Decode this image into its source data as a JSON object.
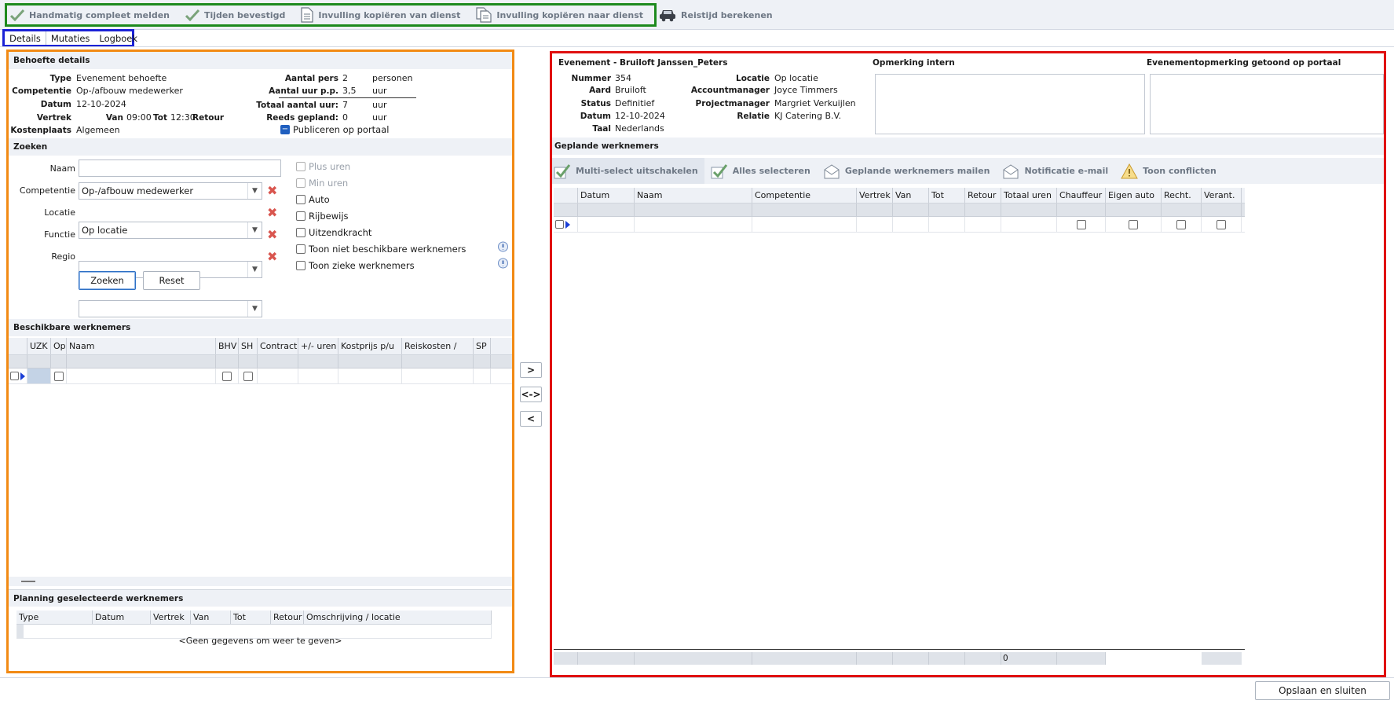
{
  "toolbar": {
    "items": [
      {
        "label": "Handmatig compleet melden",
        "icon": "checkmark-icon"
      },
      {
        "label": "Tijden bevestigd",
        "icon": "checkmark-icon"
      },
      {
        "label": "Invulling kopiëren van dienst",
        "icon": "document-icon"
      },
      {
        "label": "Invulling kopiëren naar dienst",
        "icon": "copy-documents-icon"
      },
      {
        "label": "Reistijd berekenen",
        "icon": "car-icon"
      }
    ]
  },
  "tabs": [
    "Details",
    "Mutaties",
    "Logboek"
  ],
  "behoefte": {
    "title": "Behoefte details",
    "type_label": "Type",
    "type_value": "Evenement behoefte",
    "competentie_label": "Competentie",
    "competentie_value": "Op-/afbouw medewerker",
    "datum_label": "Datum",
    "datum_value": "12-10-2024",
    "vertrek_label": "Vertrek",
    "van_label": "Van",
    "van_value": "09:00",
    "tot_label": "Tot",
    "tot_value": "12:30",
    "retour_label": "Retour",
    "kostenplaats_label": "Kostenplaats",
    "kostenplaats_value": "Algemeen",
    "aantal_pers_label": "Aantal pers",
    "aantal_pers_value": "2",
    "aantal_pers_unit": "personen",
    "aantal_uur_label": "Aantal uur p.p.",
    "aantal_uur_value": "3,5",
    "aantal_uur_unit": "uur",
    "totaal_label": "Totaal aantal uur:",
    "totaal_value": "7",
    "totaal_unit": "uur",
    "reeds_label": "Reeds gepland:",
    "reeds_value": "0",
    "reeds_unit": "uur",
    "publiceren_label": "Publiceren op portaal"
  },
  "zoeken": {
    "title": "Zoeken",
    "naam_label": "Naam",
    "naam_value": "",
    "competentie_label": "Competentie",
    "competentie_value": "Op-/afbouw medewerker",
    "locatie_label": "Locatie",
    "locatie_value": "Op locatie",
    "functie_label": "Functie",
    "functie_value": "",
    "regio_label": "Regio",
    "regio_value": "",
    "zoeken_button": "Zoeken",
    "reset_button": "Reset",
    "checkboxes": [
      "Plus uren",
      "Min uren",
      "Auto",
      "Rijbewijs",
      "Uitzendkracht",
      "Toon niet beschikbare werknemers",
      "Toon zieke werknemers"
    ]
  },
  "beschikbare": {
    "title": "Beschikbare werknemers",
    "columns": [
      "",
      "UZK",
      "Op",
      "Naam",
      "BHV",
      "SH",
      "Contract",
      "+/- uren",
      "Kostprijs p/u",
      "Reiskosten /",
      "SP"
    ]
  },
  "planning": {
    "title": "Planning geselecteerde werknemers",
    "columns": [
      "Type",
      "Datum",
      "Vertrek",
      "Van",
      "Tot",
      "Retour",
      "Omschrijving / locatie"
    ],
    "empty_text": "<Geen gegevens om weer te geven>"
  },
  "move_buttons": [
    ">",
    "<->",
    "<"
  ],
  "evenement": {
    "title": "Evenement - Bruiloft Janssen_Peters",
    "nummer_label": "Nummer",
    "nummer_value": "354",
    "aard_label": "Aard",
    "aard_value": "Bruiloft",
    "status_label": "Status",
    "status_value": "Definitief",
    "datum_label": "Datum",
    "datum_value": "12-10-2024",
    "taal_label": "Taal",
    "taal_value": "Nederlands",
    "locatie_label": "Locatie",
    "locatie_value": "Op locatie",
    "accountmanager_label": "Accountmanager",
    "accountmanager_value": "Joyce Timmers",
    "projectmanager_label": "Projectmanager",
    "projectmanager_value": "Margriet Verkuijlen",
    "relatie_label": "Relatie",
    "relatie_value": "KJ Catering B.V.",
    "opmerking_intern_label": "Opmerking intern",
    "opmerking_portaal_label": "Evenementopmerking getoond op portaal"
  },
  "geplande": {
    "title": "Geplande werknemers",
    "toolbar": [
      {
        "label": "Multi-select uitschakelen",
        "icon": "checkmark-icon"
      },
      {
        "label": "Alles selecteren",
        "icon": "checkmark-icon"
      },
      {
        "label": "Geplande werknemers mailen",
        "icon": "envelope-icon"
      },
      {
        "label": "Notificatie e-mail",
        "icon": "envelope-icon"
      },
      {
        "label": "Toon conflicten",
        "icon": "warning-icon"
      }
    ],
    "columns": [
      "",
      "Datum",
      "Naam",
      "Competentie",
      "Vertrek",
      "Van",
      "Tot",
      "Retour",
      "Totaal uren",
      "Chauffeur",
      "Eigen auto",
      "Recht.",
      "Verant."
    ],
    "footer_total": "0"
  },
  "save_button": "Opslaan en sluiten"
}
